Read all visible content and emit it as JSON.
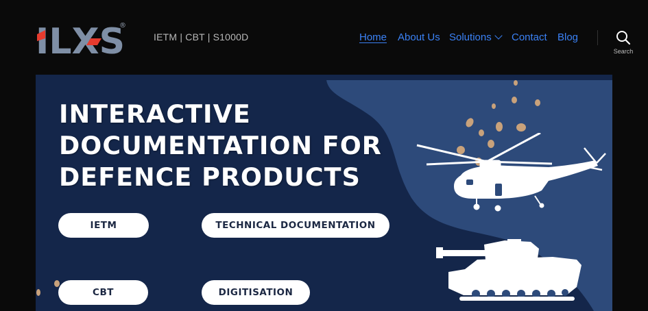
{
  "brand": {
    "logo_text": "ILXS",
    "registered_mark": "®",
    "tagline": "IETM | CBT | S1000D",
    "colors": {
      "logo_grey": "#7f8fa6",
      "logo_red": "#e63b2e",
      "header_bg": "#0a0a0a"
    }
  },
  "nav": {
    "items": [
      {
        "label": "Home",
        "active": true
      },
      {
        "label": "About Us",
        "active": false
      },
      {
        "label": "Solutions",
        "active": false,
        "has_dropdown": true
      },
      {
        "label": "Contact",
        "active": false
      },
      {
        "label": "Blog",
        "active": false
      }
    ],
    "link_color": "#3b82f6"
  },
  "search": {
    "label": "Search",
    "icon": "search-icon"
  },
  "hero": {
    "headline": [
      "INTERACTIVE",
      "DOCUMENTATION FOR",
      "DEFENCE PRODUCTS"
    ],
    "buttons": {
      "ietm": "IETM",
      "technical_documentation": "TECHNICAL DOCUMENTATION",
      "cbt": "CBT",
      "digitisation": "DIGITISATION"
    },
    "colors": {
      "dark_navy": "#14264a",
      "panel_blue": "#2d4a7a",
      "accent_tan": "#c9a27b"
    },
    "illustrations": [
      "helicopter-icon",
      "tank-icon"
    ]
  }
}
